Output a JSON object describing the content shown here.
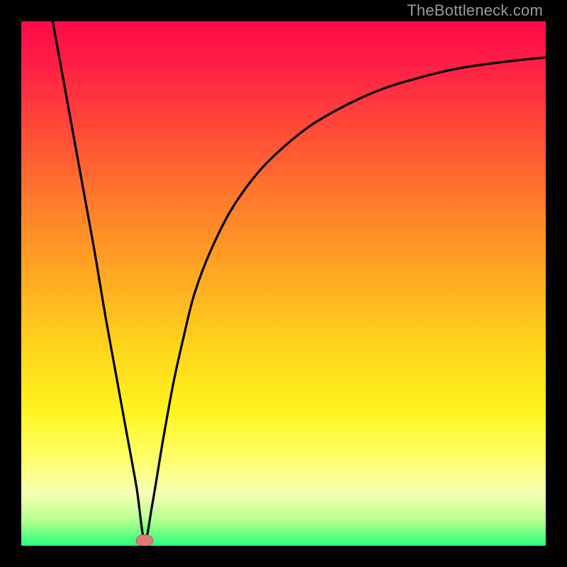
{
  "watermark": "TheBottleneck.com",
  "colors": {
    "background": "#000000",
    "curve": "#000000",
    "marker_fill": "#e07a7a",
    "marker_stroke": "#bb5b5b",
    "gradient_top": "#ff0b4a",
    "gradient_bottom": "#28ff7c"
  },
  "chart_data": {
    "type": "line",
    "title": "",
    "xlabel": "",
    "ylabel": "",
    "xlim": [
      0,
      100
    ],
    "ylim": [
      0,
      100
    ],
    "series": [
      {
        "name": "bottleneck-curve",
        "x": [
          6,
          8,
          10,
          12,
          14,
          16,
          18,
          20,
          22,
          23.5,
          25,
          27,
          29,
          31,
          33,
          36,
          40,
          45,
          50,
          55,
          60,
          65,
          70,
          75,
          80,
          85,
          90,
          95,
          100
        ],
        "y": [
          100,
          89,
          78,
          67,
          56,
          44,
          33,
          22,
          11,
          1,
          8,
          20,
          31,
          40,
          48,
          56,
          64,
          71,
          76,
          80,
          83,
          85.5,
          87.5,
          89,
          90.3,
          91.3,
          92,
          92.6,
          93.1
        ]
      }
    ],
    "marker": {
      "x": 23.5,
      "y": 1,
      "rx": 1.6,
      "ry": 1.1
    }
  }
}
